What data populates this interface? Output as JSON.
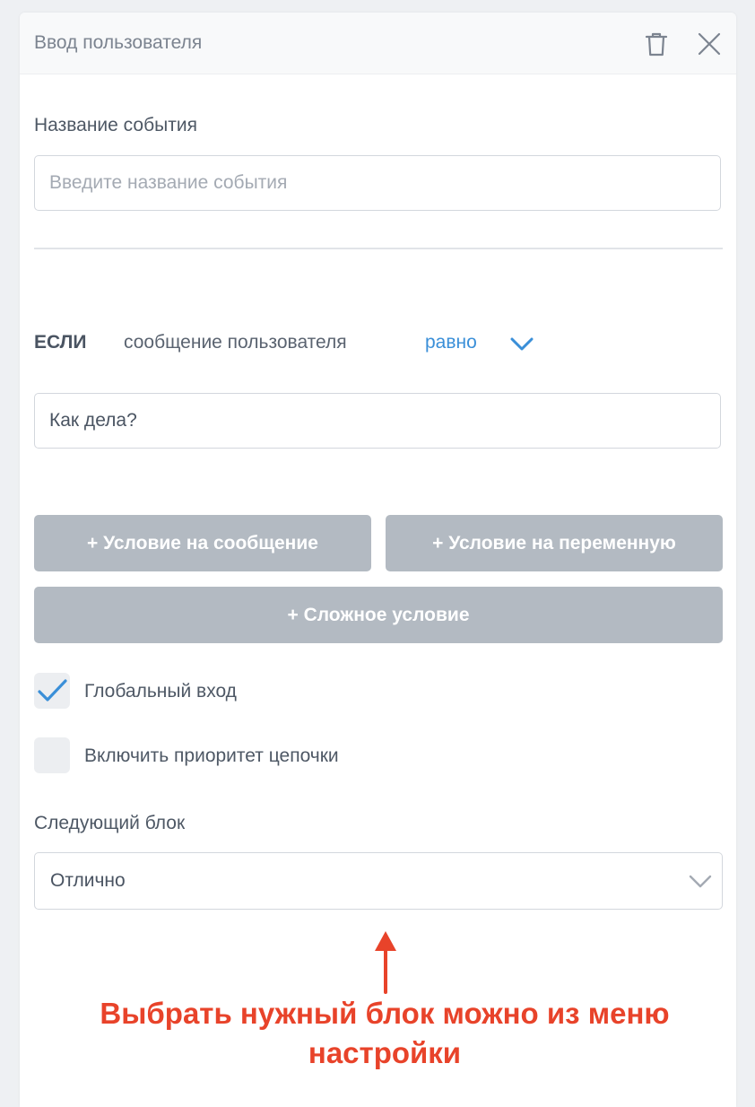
{
  "header": {
    "title": "Ввод пользователя",
    "icons": [
      "trash-icon",
      "close-icon"
    ]
  },
  "event": {
    "label": "Название события",
    "placeholder": "Введите название события",
    "value": ""
  },
  "condition": {
    "if_word": "ЕСЛИ",
    "subject": "сообщение пользователя",
    "operator": "равно",
    "value": "Как дела?"
  },
  "buttons": {
    "message_condition": "+ Условие на сообщение",
    "variable_condition": "+ Условие на переменную",
    "complex_condition": "+ Сложное условие"
  },
  "options": {
    "global_entry": {
      "label": "Глобальный вход",
      "checked": true
    },
    "chain_priority": {
      "label": "Включить приоритет цепочки",
      "checked": false
    }
  },
  "next_block": {
    "label": "Следующий блок",
    "value": "Отлично"
  },
  "annotation": {
    "line1": "Выбрать нужный блок можно из меню",
    "line2": "настройки"
  },
  "colors": {
    "accent": "#3a8fd8",
    "button": "#b3bac2",
    "annotation": "#e8432a"
  }
}
